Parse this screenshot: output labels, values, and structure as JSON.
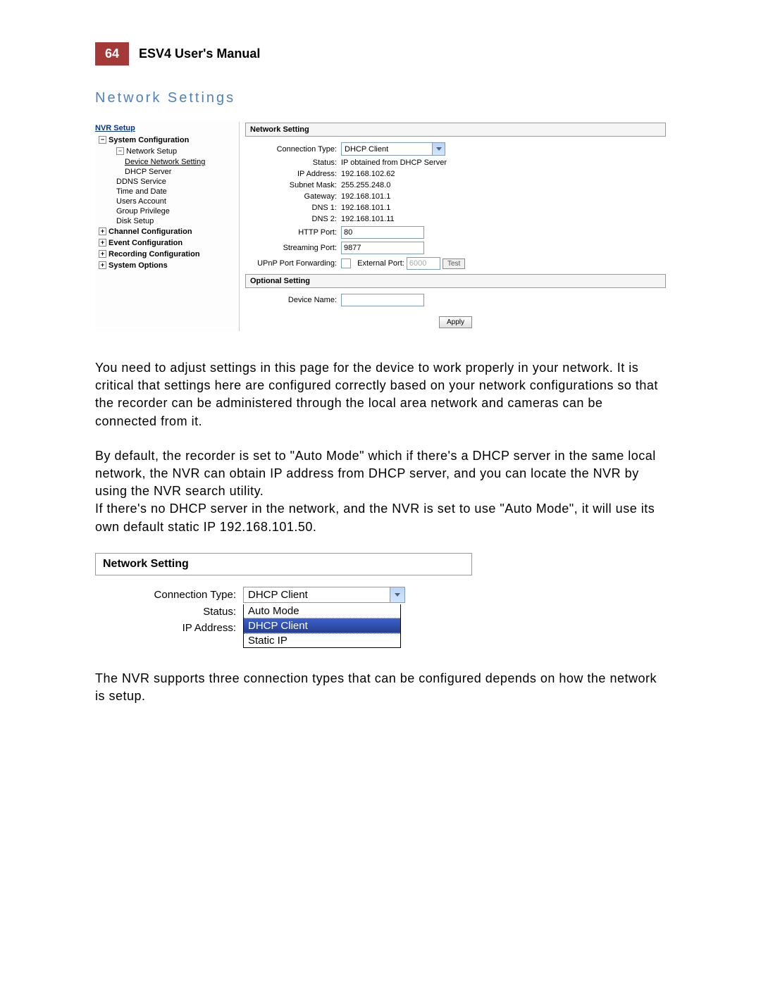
{
  "header": {
    "page_num": "64",
    "manual_title": "ESV4 User's Manual"
  },
  "section_title": "Network Settings",
  "nav": {
    "root": "NVR Setup",
    "l1a": "System Configuration",
    "l2a": "Network Setup",
    "l3a": "Device Network Setting",
    "l3b": "DHCP Server",
    "l3c": "DDNS Service",
    "l3d": "Time and Date",
    "l3e": "Users Account",
    "l3f": "Group Privilege",
    "l3g": "Disk Setup",
    "l1b": "Channel Configuration",
    "l1c": "Event Configuration",
    "l1d": "Recording Configuration",
    "l1e": "System Options"
  },
  "form1": {
    "header": "Network Setting",
    "conn_type_label": "Connection Type:",
    "conn_type_value": "DHCP Client",
    "status_label": "Status:",
    "status_value": "IP obtained from DHCP Server",
    "ip_label": "IP Address:",
    "ip_value": "192.168.102.62",
    "subnet_label": "Subnet Mask:",
    "subnet_value": "255.255.248.0",
    "gateway_label": "Gateway:",
    "gateway_value": "192.168.101.1",
    "dns1_label": "DNS 1:",
    "dns1_value": "192.168.101.1",
    "dns2_label": "DNS 2:",
    "dns2_value": "192.168.101.11",
    "http_label": "HTTP Port:",
    "http_value": "80",
    "stream_label": "Streaming Port:",
    "stream_value": "9877",
    "upnp_label": "UPnP Port Forwarding:",
    "ext_port_label": "External Port:",
    "ext_port_value": "6000",
    "test_btn": "Test",
    "opt_header": "Optional Setting",
    "devname_label": "Device Name:",
    "devname_value": "",
    "apply_btn": "Apply"
  },
  "para1": "You need to adjust settings in this page for the device to work properly in your network. It is critical that settings here are configured correctly based on your network configurations so that the recorder can be administered through the local area network and cameras can be connected from it.",
  "para2": "By default, the recorder is set to \"Auto Mode\" which if there's a DHCP server in the same local network, the NVR can obtain IP address from DHCP server, and you can locate the NVR by using the NVR search utility.",
  "para3": "If there's no DHCP server in the network, and the NVR is set to use \"Auto Mode\", it will use its own default static IP 192.168.101.50.",
  "form2": {
    "header": "Network Setting",
    "conn_type_label": "Connection Type:",
    "conn_type_value": "DHCP Client",
    "status_label": "Status:",
    "ip_label": "IP Address:",
    "opt_auto": "Auto Mode",
    "opt_dhcp": "DHCP Client",
    "opt_static": "Static IP"
  },
  "para4": "The NVR supports three connection types that can be configured depends on how the network is setup."
}
